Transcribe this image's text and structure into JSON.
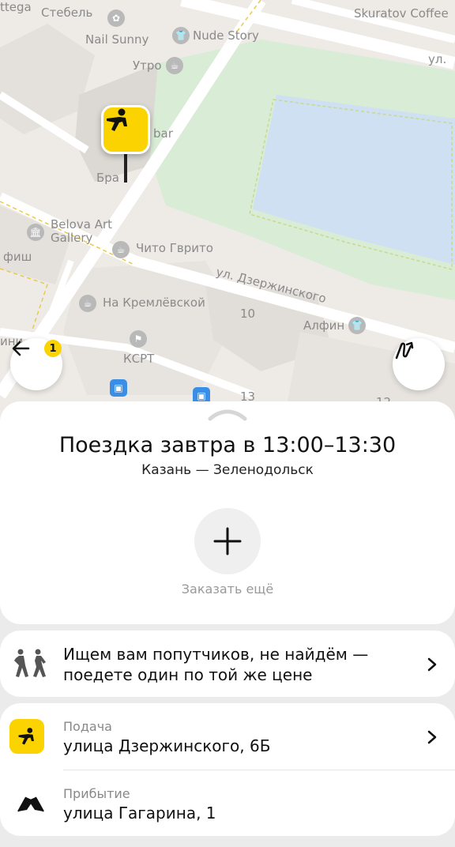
{
  "map": {
    "labels": {
      "ttega": "ttega",
      "stebel": "Стебель",
      "skuratov": "Skuratov Coffee",
      "nail_sunny": "Nail Sunny",
      "nude_story": "Nude Story",
      "utro": "Утро",
      "ul_top": "ул.",
      "bar": "bar",
      "bra": "Бра",
      "belova": "Belova Art",
      "gallery": "Gallery",
      "fish": "фиш",
      "chito": "Чито Гврито",
      "dzerzh_street": "ул. Дзержинского",
      "kreml": "На Кремлёвской",
      "num10": "10",
      "alfin": "Алфин",
      "ksrt": "КСРТ",
      "ini": "ини",
      "num13": "13",
      "num12": "12"
    },
    "back_badge": "1"
  },
  "trip": {
    "title": "Поездка завтра в 13:00–13:30",
    "route": "Казань — Зеленодольск",
    "add_label": "Заказать ещё"
  },
  "companions": {
    "text": "Ищем вам попутчиков, не найдём — поедете один по той же цене",
    "line1": "Ищем вам попутчиков, не найдём —",
    "line2": "поедете один по той же цене"
  },
  "pickup": {
    "label": "Подача",
    "address": "улица Дзержинского, 6Б"
  },
  "arrival": {
    "label": "Прибытие",
    "address": "улица Гагарина, 1"
  },
  "colors": {
    "accent": "#fbd300",
    "map_bg": "#eeebe6",
    "park": "#d8ecd6",
    "water": "#cfe0f3"
  },
  "icons": {
    "pin": "person-pointing-icon",
    "back": "arrow-left-icon",
    "route": "route-icon",
    "add": "plus-icon",
    "companions": "people-walking-icon",
    "arrival": "flags-icon",
    "chevron": "chevron-right-icon"
  }
}
